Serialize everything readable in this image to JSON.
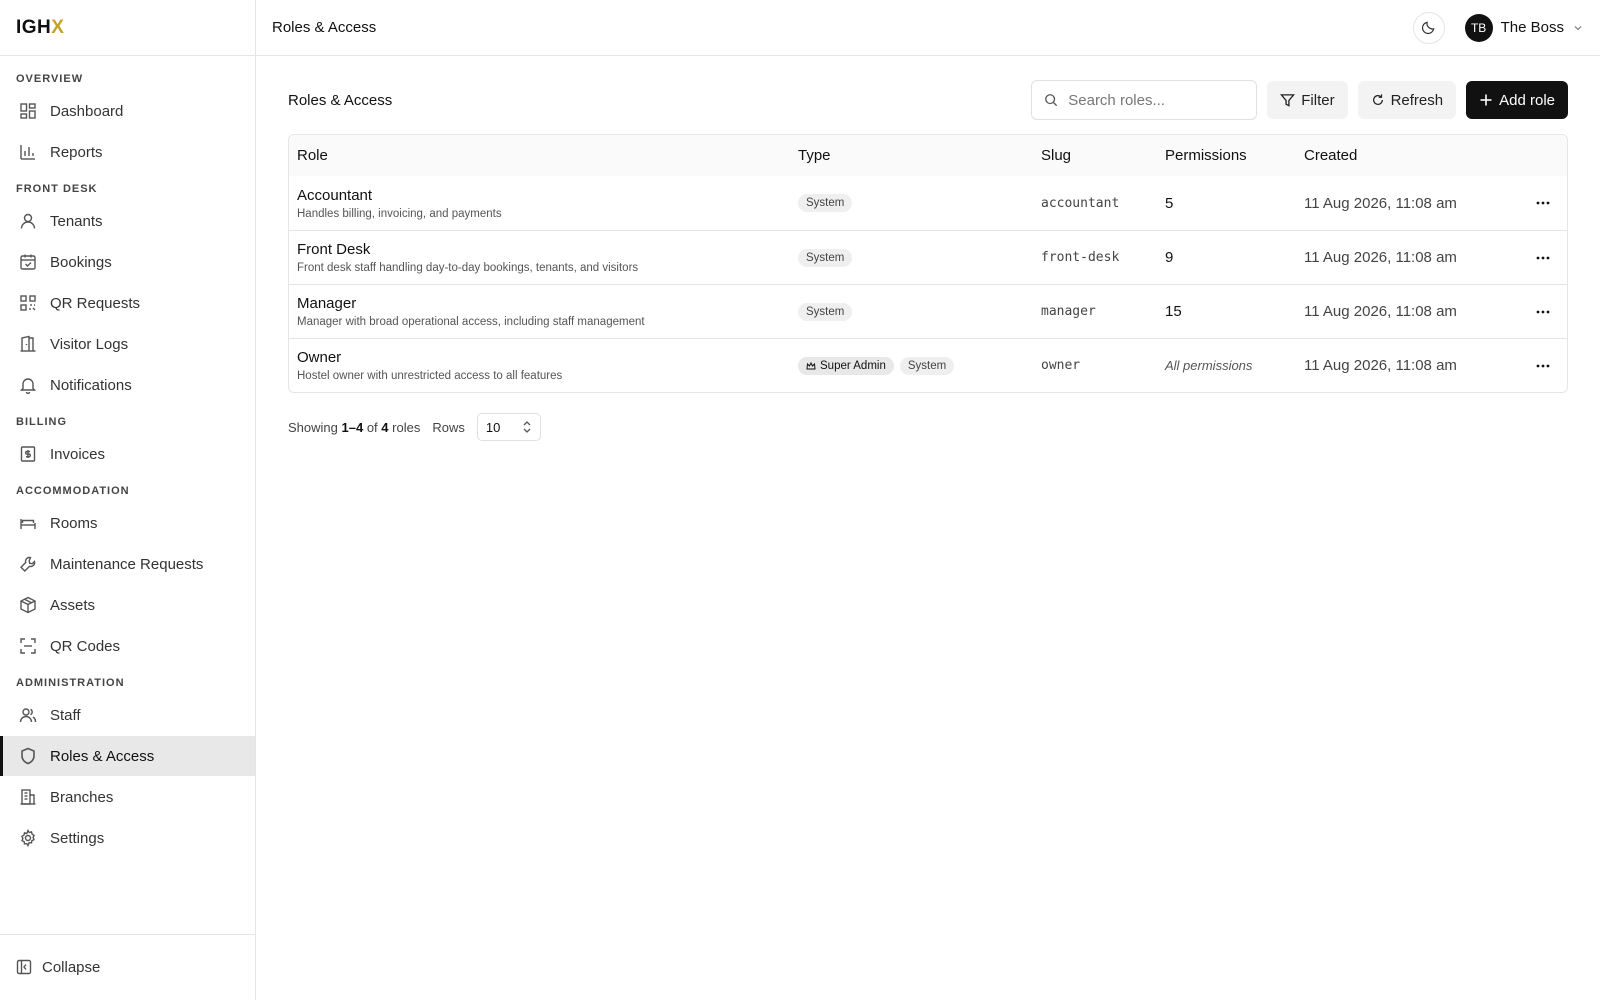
{
  "app": {
    "logo_main": "IGH",
    "logo_accent": "X"
  },
  "topbar": {
    "title": "Roles & Access",
    "user_initials": "TB",
    "user_name": "The Boss"
  },
  "sidebar": {
    "sections": [
      {
        "label": "OVERVIEW",
        "items": [
          {
            "label": "Dashboard",
            "icon": "dashboard-icon"
          },
          {
            "label": "Reports",
            "icon": "bar-chart-icon"
          }
        ]
      },
      {
        "label": "FRONT DESK",
        "items": [
          {
            "label": "Tenants",
            "icon": "user-icon"
          },
          {
            "label": "Bookings",
            "icon": "calendar-check-icon"
          },
          {
            "label": "QR Requests",
            "icon": "qr-icon"
          },
          {
            "label": "Visitor Logs",
            "icon": "door-icon"
          },
          {
            "label": "Notifications",
            "icon": "bell-icon"
          }
        ]
      },
      {
        "label": "BILLING",
        "items": [
          {
            "label": "Invoices",
            "icon": "dollar-receipt-icon"
          }
        ]
      },
      {
        "label": "ACCOMMODATION",
        "items": [
          {
            "label": "Rooms",
            "icon": "bed-icon"
          },
          {
            "label": "Maintenance Requests",
            "icon": "wrench-icon"
          },
          {
            "label": "Assets",
            "icon": "box-icon"
          },
          {
            "label": "QR Codes",
            "icon": "scan-icon"
          }
        ]
      },
      {
        "label": "ADMINISTRATION",
        "items": [
          {
            "label": "Staff",
            "icon": "users-icon"
          },
          {
            "label": "Roles & Access",
            "icon": "shield-icon",
            "active": true
          },
          {
            "label": "Branches",
            "icon": "building-icon"
          },
          {
            "label": "Settings",
            "icon": "gear-icon"
          }
        ]
      }
    ],
    "collapse_label": "Collapse"
  },
  "main": {
    "title": "Roles & Access",
    "search_placeholder": "Search roles...",
    "filter_label": "Filter",
    "refresh_label": "Refresh",
    "add_label": "Add role"
  },
  "table": {
    "headers": {
      "role": "Role",
      "type": "Type",
      "slug": "Slug",
      "permissions": "Permissions",
      "created": "Created"
    },
    "rows": [
      {
        "name": "Accountant",
        "desc": "Handles billing, invoicing, and payments",
        "badges": [
          "System"
        ],
        "slug": "accountant",
        "permissions": "5",
        "created": "11 Aug 2026, 11:08 am"
      },
      {
        "name": "Front Desk",
        "desc": "Front desk staff handling day-to-day bookings, tenants, and visitors",
        "badges": [
          "System"
        ],
        "slug": "front-desk",
        "permissions": "9",
        "created": "11 Aug 2026, 11:08 am"
      },
      {
        "name": "Manager",
        "desc": "Manager with broad operational access, including staff management",
        "badges": [
          "System"
        ],
        "slug": "manager",
        "permissions": "15",
        "created": "11 Aug 2026, 11:08 am"
      },
      {
        "name": "Owner",
        "desc": "Hostel owner with unrestricted access to all features",
        "badges": [
          "Super Admin",
          "System"
        ],
        "slug": "owner",
        "permissions": "All permissions",
        "created": "11 Aug 2026, 11:08 am"
      }
    ]
  },
  "pager": {
    "showing": "Showing",
    "range": "1–4",
    "of": "of",
    "total": "4",
    "unit": "roles",
    "rows_label": "Rows",
    "rows_value": "10"
  }
}
